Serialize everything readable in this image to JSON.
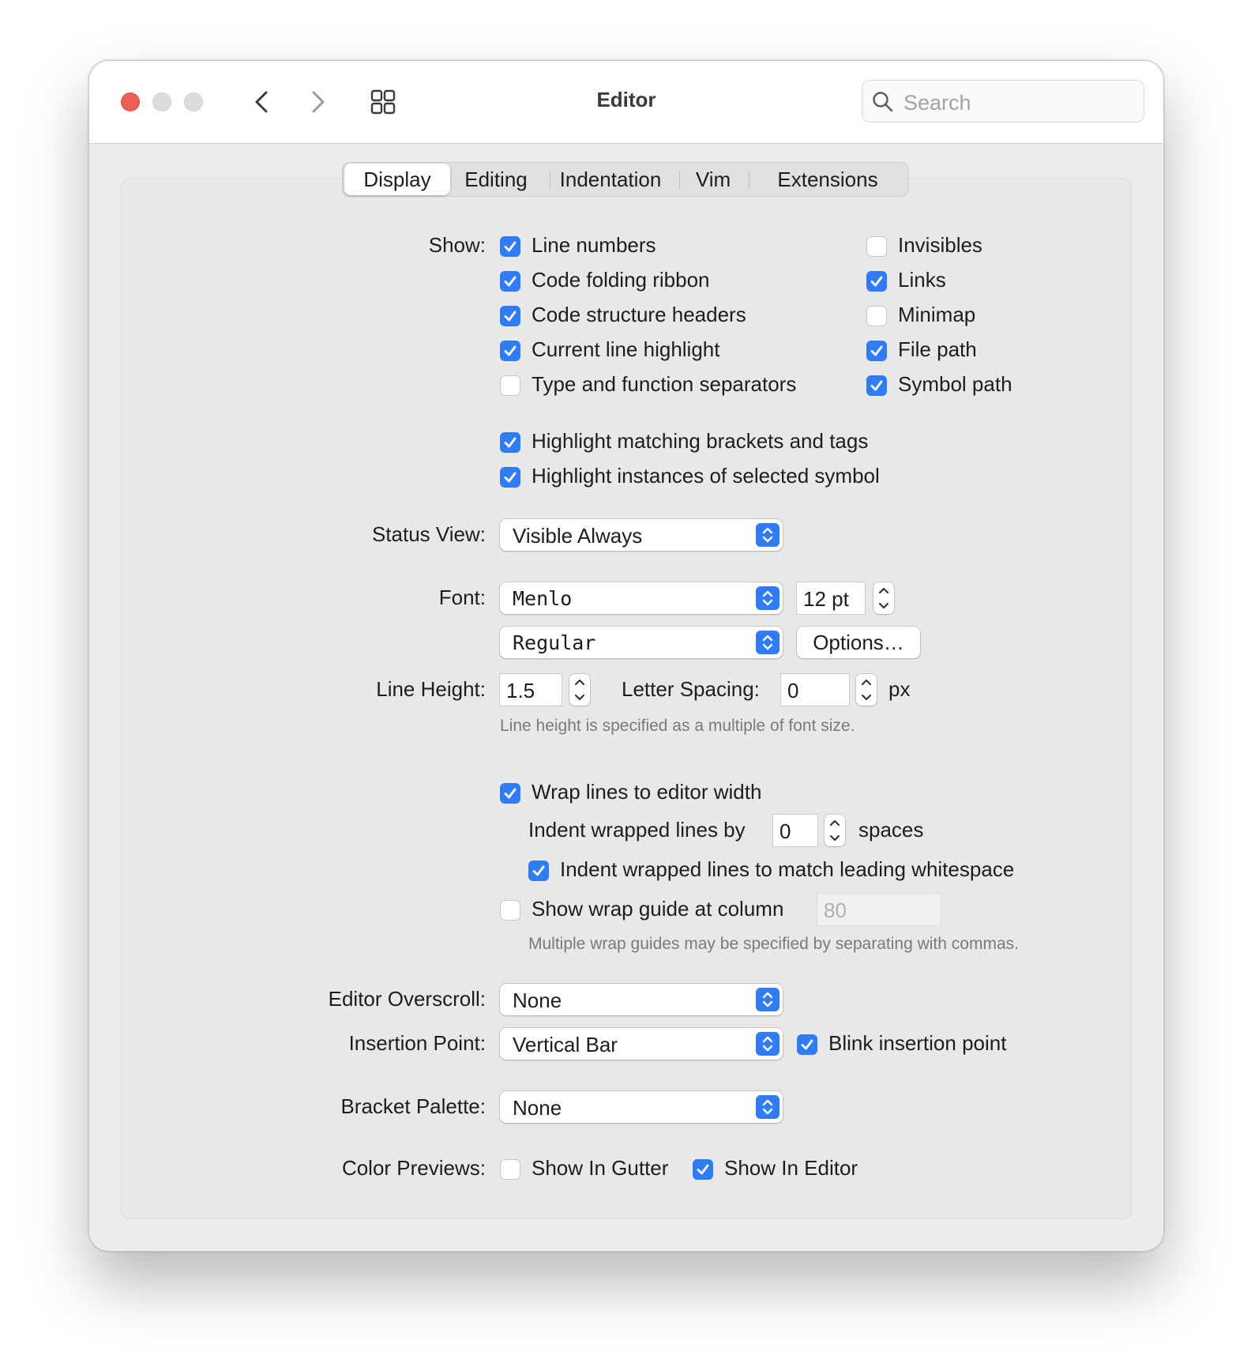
{
  "window": {
    "title": "Editor",
    "search_placeholder": "Search"
  },
  "tabs": [
    "Display",
    "Editing",
    "Indentation",
    "Vim",
    "Extensions"
  ],
  "active_tab": "Display",
  "show": {
    "label": "Show:",
    "left": [
      {
        "label": "Line numbers",
        "checked": true
      },
      {
        "label": "Code folding ribbon",
        "checked": true
      },
      {
        "label": "Code structure headers",
        "checked": true
      },
      {
        "label": "Current line highlight",
        "checked": true
      },
      {
        "label": "Type and function separators",
        "checked": false
      }
    ],
    "right": [
      {
        "label": "Invisibles",
        "checked": false
      },
      {
        "label": "Links",
        "checked": true
      },
      {
        "label": "Minimap",
        "checked": false
      },
      {
        "label": "File path",
        "checked": true
      },
      {
        "label": "Symbol path",
        "checked": true
      }
    ],
    "extra": [
      {
        "label": "Highlight matching brackets and tags",
        "checked": true
      },
      {
        "label": "Highlight instances of selected symbol",
        "checked": true
      }
    ]
  },
  "status_view": {
    "label": "Status View:",
    "value": "Visible Always"
  },
  "font": {
    "label": "Font:",
    "family": "Menlo",
    "size": "12 pt",
    "weight": "Regular",
    "options_button": "Options…"
  },
  "line_height": {
    "label": "Line Height:",
    "value": "1.5",
    "letter_spacing_label": "Letter Spacing:",
    "letter_spacing_value": "0",
    "unit": "px",
    "hint": "Line height is specified as a multiple of font size."
  },
  "wrap": {
    "wrap_lines": {
      "label": "Wrap lines to editor width",
      "checked": true
    },
    "indent_label": "Indent wrapped lines by",
    "indent_value": "0",
    "indent_unit": "spaces",
    "match_whitespace": {
      "label": "Indent wrapped lines to match leading whitespace",
      "checked": true
    },
    "wrap_guide": {
      "label": "Show wrap guide at column",
      "checked": false,
      "placeholder": "80"
    },
    "hint": "Multiple wrap guides may be specified by separating with commas."
  },
  "editor_overscroll": {
    "label": "Editor Overscroll:",
    "value": "None"
  },
  "insertion_point": {
    "label": "Insertion Point:",
    "value": "Vertical Bar",
    "blink": {
      "label": "Blink insertion point",
      "checked": true
    }
  },
  "bracket_palette": {
    "label": "Bracket Palette:",
    "value": "None"
  },
  "color_previews": {
    "label": "Color Previews:",
    "gutter": {
      "label": "Show In Gutter",
      "checked": false
    },
    "editor": {
      "label": "Show In Editor",
      "checked": true
    }
  },
  "colors": {
    "accent": "#2f7cf6",
    "close_light": "#ee5f57"
  }
}
